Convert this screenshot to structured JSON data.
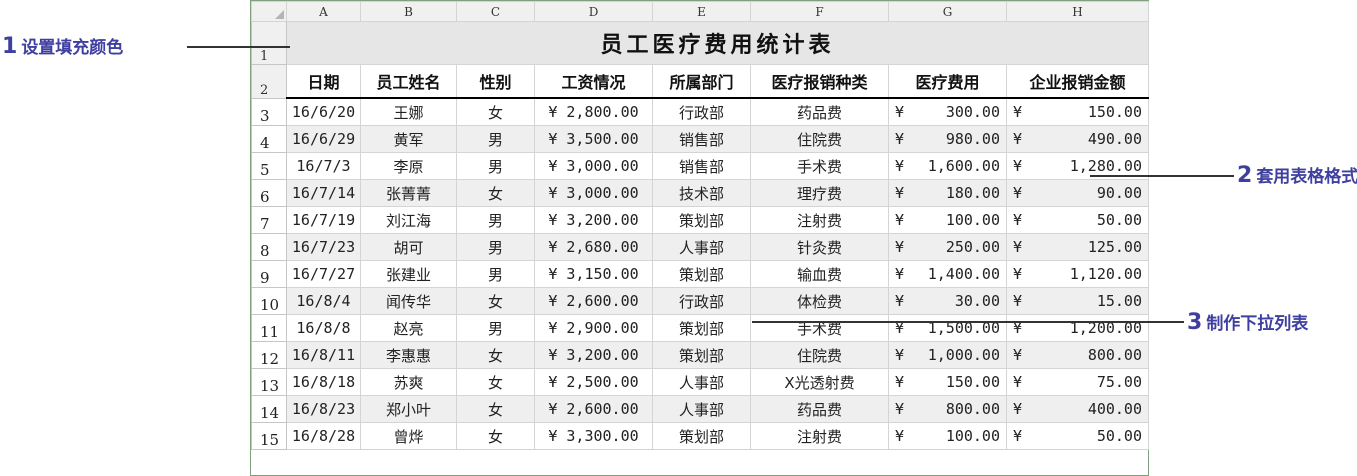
{
  "columns": [
    "A",
    "B",
    "C",
    "D",
    "E",
    "F",
    "G",
    "H"
  ],
  "rows": [
    "1",
    "2",
    "3",
    "4",
    "5",
    "6",
    "7",
    "8",
    "9",
    "10",
    "11",
    "12",
    "13",
    "14",
    "15"
  ],
  "title": "员工医疗费用统计表",
  "headers": [
    "日期",
    "员工姓名",
    "性别",
    "工资情况",
    "所属部门",
    "医疗报销种类",
    "医疗费用",
    "企业报销金额"
  ],
  "records": [
    {
      "date": "16/6/20",
      "name": "王娜",
      "sex": "女",
      "salary": "¥ 2,800.00",
      "dept": "行政部",
      "type": "药品费",
      "fee_cur": "¥",
      "fee": "300.00",
      "reimb_cur": "¥",
      "reimb": "150.00"
    },
    {
      "date": "16/6/29",
      "name": "黄军",
      "sex": "男",
      "salary": "¥ 3,500.00",
      "dept": "销售部",
      "type": "住院费",
      "fee_cur": "¥",
      "fee": "980.00",
      "reimb_cur": "¥",
      "reimb": "490.00"
    },
    {
      "date": "16/7/3",
      "name": "李原",
      "sex": "男",
      "salary": "¥ 3,000.00",
      "dept": "销售部",
      "type": "手术费",
      "fee_cur": "¥",
      "fee": "1,600.00",
      "reimb_cur": "¥",
      "reimb": "1,280.00"
    },
    {
      "date": "16/7/14",
      "name": "张菁菁",
      "sex": "女",
      "salary": "¥ 3,000.00",
      "dept": "技术部",
      "type": "理疗费",
      "fee_cur": "¥",
      "fee": "180.00",
      "reimb_cur": "¥",
      "reimb": "90.00"
    },
    {
      "date": "16/7/19",
      "name": "刘江海",
      "sex": "男",
      "salary": "¥ 3,200.00",
      "dept": "策划部",
      "type": "注射费",
      "fee_cur": "¥",
      "fee": "100.00",
      "reimb_cur": "¥",
      "reimb": "50.00"
    },
    {
      "date": "16/7/23",
      "name": "胡可",
      "sex": "男",
      "salary": "¥ 2,680.00",
      "dept": "人事部",
      "type": "针灸费",
      "fee_cur": "¥",
      "fee": "250.00",
      "reimb_cur": "¥",
      "reimb": "125.00"
    },
    {
      "date": "16/7/27",
      "name": "张建业",
      "sex": "男",
      "salary": "¥ 3,150.00",
      "dept": "策划部",
      "type": "输血费",
      "fee_cur": "¥",
      "fee": "1,400.00",
      "reimb_cur": "¥",
      "reimb": "1,120.00"
    },
    {
      "date": "16/8/4",
      "name": "闻传华",
      "sex": "女",
      "salary": "¥ 2,600.00",
      "dept": "行政部",
      "type": "体检费",
      "fee_cur": "¥",
      "fee": "30.00",
      "reimb_cur": "¥",
      "reimb": "15.00"
    },
    {
      "date": "16/8/8",
      "name": "赵亮",
      "sex": "男",
      "salary": "¥ 2,900.00",
      "dept": "策划部",
      "type": "手术费",
      "fee_cur": "¥",
      "fee": "1,500.00",
      "reimb_cur": "¥",
      "reimb": "1,200.00"
    },
    {
      "date": "16/8/11",
      "name": "李惠惠",
      "sex": "女",
      "salary": "¥ 3,200.00",
      "dept": "策划部",
      "type": "住院费",
      "fee_cur": "¥",
      "fee": "1,000.00",
      "reimb_cur": "¥",
      "reimb": "800.00"
    },
    {
      "date": "16/8/18",
      "name": "苏爽",
      "sex": "女",
      "salary": "¥ 2,500.00",
      "dept": "人事部",
      "type": "X光透射费",
      "fee_cur": "¥",
      "fee": "150.00",
      "reimb_cur": "¥",
      "reimb": "75.00"
    },
    {
      "date": "16/8/23",
      "name": "郑小叶",
      "sex": "女",
      "salary": "¥ 2,600.00",
      "dept": "人事部",
      "type": "药品费",
      "fee_cur": "¥",
      "fee": "800.00",
      "reimb_cur": "¥",
      "reimb": "400.00"
    },
    {
      "date": "16/8/28",
      "name": "曾烨",
      "sex": "女",
      "salary": "¥ 3,300.00",
      "dept": "策划部",
      "type": "注射费",
      "fee_cur": "¥",
      "fee": "100.00",
      "reimb_cur": "¥",
      "reimb": "50.00"
    }
  ],
  "callouts": [
    {
      "num": "1",
      "text": "设置填充颜色"
    },
    {
      "num": "2",
      "text": "套用表格格式"
    },
    {
      "num": "3",
      "text": "制作下拉列表"
    }
  ],
  "colors": {
    "accent": "#3f3f9f",
    "title_fill": "#e6e6e6",
    "band_fill": "#efefef"
  }
}
